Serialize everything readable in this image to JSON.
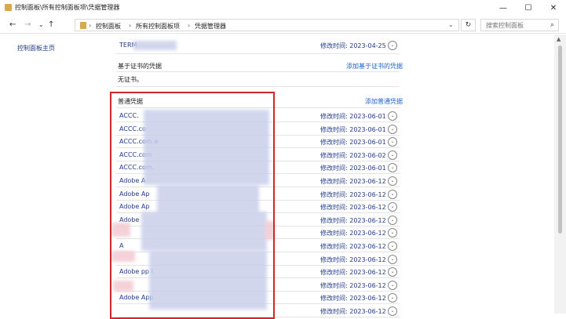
{
  "window": {
    "title": "控制面板\\所有控制面板项\\凭据管理器",
    "minimize": "—",
    "maximize": "☐",
    "close": "✕"
  },
  "nav": {
    "back": "←",
    "forward": "→",
    "dropdown": "⌄",
    "up": "↑",
    "breadcrumb": [
      "控制面板",
      "所有控制面板项",
      "凭据管理器"
    ],
    "crumb_sep": "›",
    "addr_dropdown": "⌄",
    "refresh": "↻",
    "search_placeholder": "搜索控制面板",
    "search_glyph": "⌕"
  },
  "sidebar": {
    "home_link": "控制面板主页"
  },
  "top_entry": {
    "name": "TERM",
    "date": "修改时间:  2023-04-25"
  },
  "cert_section": {
    "title": "基于证书的凭据",
    "add_link": "添加基于证书的凭据",
    "empty_text": "无证书。"
  },
  "generic_section": {
    "title": "普通凭据",
    "add_link": "添加普通凭据",
    "items": [
      {
        "name": "ACCC.",
        "date": "修改时间:  2023-06-01"
      },
      {
        "name": "ACCC.co",
        "date": "修改时间:  2023-06-01"
      },
      {
        "name": "ACCC.com.a",
        "date": "修改时间:  2023-06-01"
      },
      {
        "name": "ACCC.com",
        "date": "修改时间:  2023-06-02"
      },
      {
        "name": "ACCC.com.",
        "date": "修改时间:  2023-06-01"
      },
      {
        "name": "Adobe A",
        "date": "修改时间:  2023-06-12"
      },
      {
        "name": "Adobe Ap",
        "date": "修改时间:  2023-06-12"
      },
      {
        "name": "Adobe Ap",
        "date": "修改时间:  2023-06-12"
      },
      {
        "name": "Adobe",
        "date": "修改时间:  2023-06-12"
      },
      {
        "name": "",
        "date": "修改时间:  2023-06-12"
      },
      {
        "name": "A",
        "date": "修改时间:  2023-06-12"
      },
      {
        "name": "",
        "date": "修改时间:  2023-06-12"
      },
      {
        "name": "Adobe  pp I",
        "date": "修改时间:  2023-06-12"
      },
      {
        "name": "",
        "date": "修改时间:  2023-06-12"
      },
      {
        "name": "Adobe App",
        "date": "修改时间:  2023-06-12"
      },
      {
        "name": "",
        "date": "修改时间:  2023-06-12"
      }
    ]
  },
  "expand_glyph": "⌄",
  "scroll_up_glyph": "▲",
  "colors": {
    "link": "#1f3a8a",
    "action_link": "#1f64c8",
    "highlight_box": "#d02828",
    "redaction": "#c9cfea"
  }
}
